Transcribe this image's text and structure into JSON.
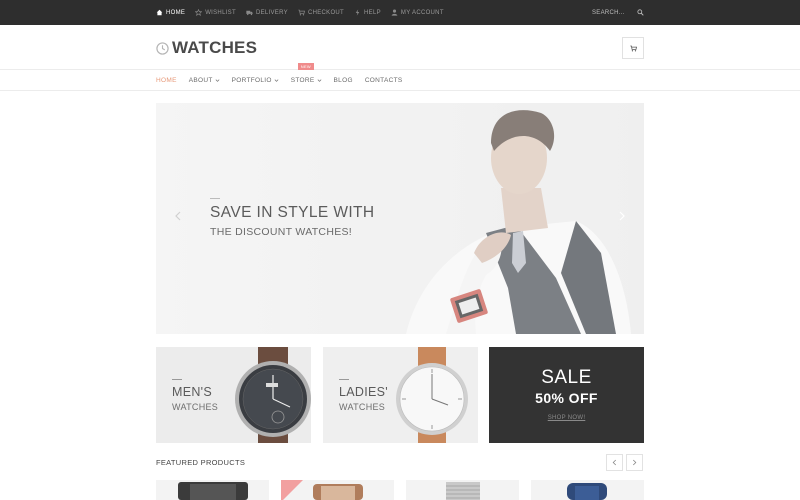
{
  "topbar": {
    "links": [
      {
        "label": "HOME",
        "icon": "home-icon"
      },
      {
        "label": "WISHLIST",
        "icon": "star-icon"
      },
      {
        "label": "DELIVERY",
        "icon": "truck-icon"
      },
      {
        "label": "CHECKOUT",
        "icon": "cart-icon"
      },
      {
        "label": "HELP",
        "icon": "lightning-icon"
      },
      {
        "label": "MY ACCOUNT",
        "icon": "user-icon"
      }
    ],
    "search_placeholder": "SEARCH...",
    "search_icon": "search-icon"
  },
  "header": {
    "logo_text": "WATCHES",
    "logo_icon": "clock-icon",
    "cart_icon": "cart-icon"
  },
  "nav": {
    "items": [
      {
        "label": "HOME"
      },
      {
        "label": "ABOUT"
      },
      {
        "label": "PORTFOLIO"
      },
      {
        "label": "STORE",
        "badge": "NEW"
      },
      {
        "label": "BLOG"
      },
      {
        "label": "CONTACTS"
      }
    ]
  },
  "hero": {
    "title": "SAVE IN STYLE WITH",
    "subtitle": "THE DISCOUNT WATCHES!"
  },
  "banners": {
    "men": {
      "line1": "MEN'S",
      "line2": "WATCHES"
    },
    "ladies": {
      "line1": "LADIES'",
      "line2": "WATCHES"
    },
    "sale": {
      "line1": "SALE",
      "line2": "50% OFF",
      "link": "SHOP NOW!"
    }
  },
  "featured": {
    "title": "FEATURED PRODUCTS",
    "prev_icon": "chevron-left-icon",
    "next_icon": "chevron-right-icon"
  },
  "colors": {
    "topbar_bg": "#2e2e2e",
    "accent": "#e79a7a",
    "badge": "#f08b8b",
    "sale_bg": "#333333"
  }
}
